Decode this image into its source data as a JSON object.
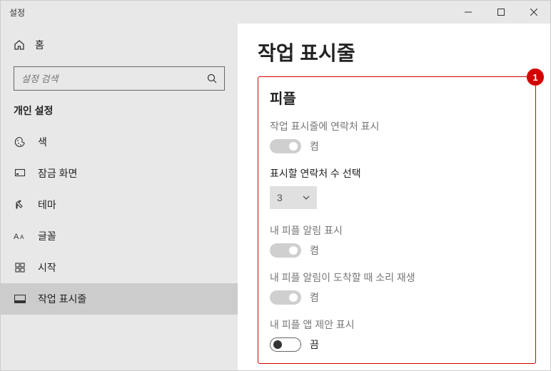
{
  "window": {
    "title": "설정"
  },
  "sidebar": {
    "home": "홈",
    "searchPlaceholder": "설정 검색",
    "sectionTitle": "개인 설정",
    "items": [
      {
        "label": "색"
      },
      {
        "label": "잠금 화면"
      },
      {
        "label": "테마"
      },
      {
        "label": "글꼴"
      },
      {
        "label": "시작"
      },
      {
        "label": "작업 표시줄"
      }
    ]
  },
  "main": {
    "title": "작업 표시줄",
    "badge": "1",
    "people": {
      "heading": "피플",
      "showContactsLabel": "작업 표시줄에 연락처 표시",
      "showContactsState": "켬",
      "contactCountLabel": "표시할 연락처 수 선택",
      "contactCountValue": "3",
      "notifLabel": "내 피플 알림 표시",
      "notifState": "켬",
      "soundLabel": "내 피플 알림이 도착할 때 소리 재생",
      "soundState": "켬",
      "suggestLabel": "내 피플 앱 제안 표시",
      "suggestState": "끔"
    }
  }
}
